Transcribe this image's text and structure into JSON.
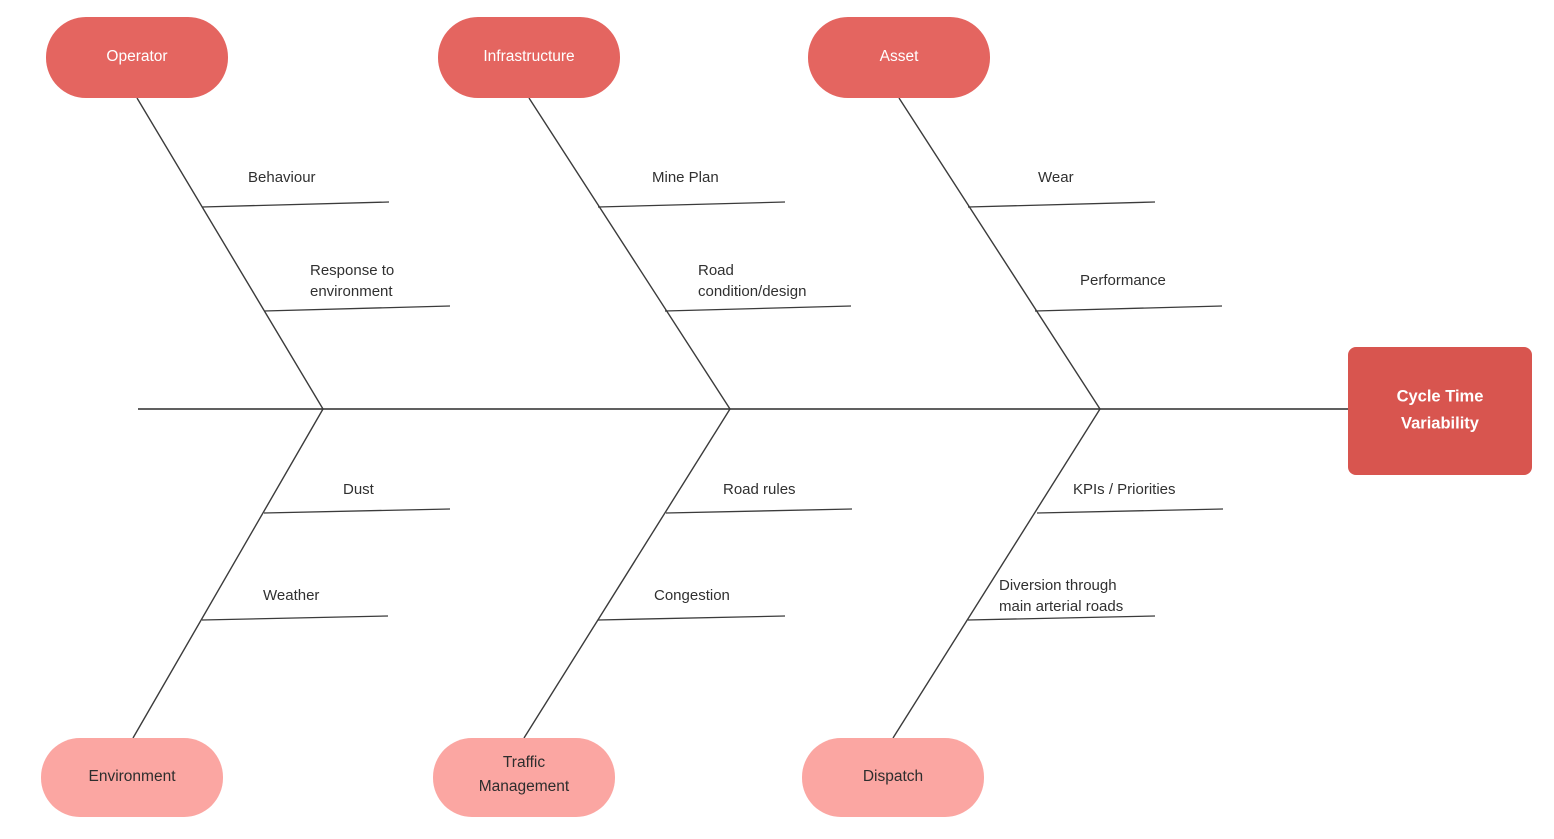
{
  "diagram": {
    "type": "fishbone-ishikawa",
    "title": "Cycle Time Variability",
    "head": {
      "label_line1": "Cycle Time",
      "label_line2": "Variability",
      "fill": "#d8554f",
      "text_color": "#ffffff"
    },
    "colors": {
      "top_category_fill": "#e46560",
      "bottom_category_fill": "#fba6a2",
      "top_category_text": "#ffffff",
      "bottom_category_text": "#2d2d2d",
      "bone_stroke": "#3b3b3b",
      "background": "#ffffff"
    },
    "categories": [
      {
        "id": "operator",
        "label": "Operator",
        "label_line1": "Operator",
        "label_line2": "",
        "position": "top",
        "causes": [
          {
            "label": "Behaviour",
            "label_line1": "Behaviour",
            "label_line2": ""
          },
          {
            "label": "Response to environment",
            "label_line1": "Response to",
            "label_line2": "environment"
          }
        ]
      },
      {
        "id": "infrastructure",
        "label": "Infrastructure",
        "label_line1": "Infrastructure",
        "label_line2": "",
        "position": "top",
        "causes": [
          {
            "label": "Mine Plan",
            "label_line1": "Mine Plan",
            "label_line2": ""
          },
          {
            "label": "Road condition/design",
            "label_line1": "Road",
            "label_line2": "condition/design"
          }
        ]
      },
      {
        "id": "asset",
        "label": "Asset",
        "label_line1": "Asset",
        "label_line2": "",
        "position": "top",
        "causes": [
          {
            "label": "Wear",
            "label_line1": "Wear",
            "label_line2": ""
          },
          {
            "label": "Performance",
            "label_line1": "Performance",
            "label_line2": ""
          }
        ]
      },
      {
        "id": "environment",
        "label": "Environment",
        "label_line1": "Environment",
        "label_line2": "",
        "position": "bottom",
        "causes": [
          {
            "label": "Dust",
            "label_line1": "Dust",
            "label_line2": ""
          },
          {
            "label": "Weather",
            "label_line1": "Weather",
            "label_line2": ""
          }
        ]
      },
      {
        "id": "traffic-management",
        "label": "Traffic Management",
        "label_line1": "Traffic",
        "label_line2": "Management",
        "position": "bottom",
        "causes": [
          {
            "label": "Road rules",
            "label_line1": "Road rules",
            "label_line2": ""
          },
          {
            "label": "Congestion",
            "label_line1": "Congestion",
            "label_line2": ""
          }
        ]
      },
      {
        "id": "dispatch",
        "label": "Dispatch",
        "label_line1": "Dispatch",
        "label_line2": "",
        "position": "bottom",
        "causes": [
          {
            "label": "KPIs / Priorities",
            "label_line1": "KPIs / Priorities",
            "label_line2": ""
          },
          {
            "label": "Diversion through main arterial roads",
            "label_line1": "Diversion through",
            "label_line2": "main arterial roads"
          }
        ]
      }
    ]
  }
}
